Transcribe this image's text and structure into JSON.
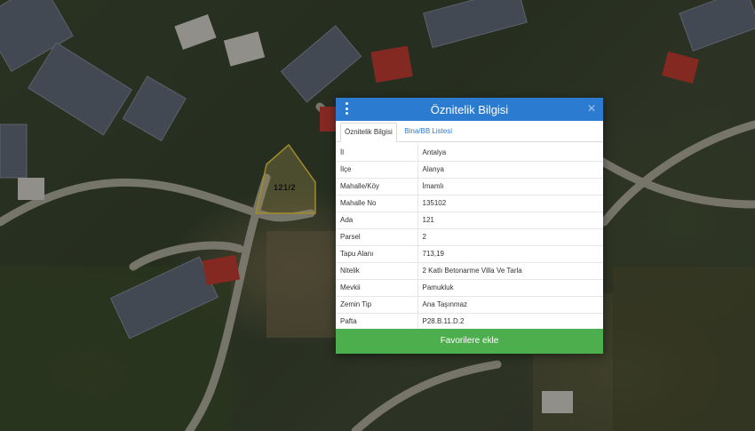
{
  "map": {
    "parcel_label": "121/2"
  },
  "dialog": {
    "title": "Öznitelik Bilgisi",
    "menu_icon": "vertical-dots-icon",
    "close_icon": "close-icon",
    "tabs": [
      {
        "label": "Öznitelik Bilgisi",
        "active": true
      },
      {
        "label": "Bina/BB Listesi",
        "active": false
      }
    ],
    "rows": [
      {
        "key": "İl",
        "value": "Antalya"
      },
      {
        "key": "İlçe",
        "value": "Alanya"
      },
      {
        "key": "Mahalle/Köy",
        "value": "İmamlı"
      },
      {
        "key": "Mahalle No",
        "value": "135102"
      },
      {
        "key": "Ada",
        "value": "121"
      },
      {
        "key": "Parsel",
        "value": "2"
      },
      {
        "key": "Tapu Alanı",
        "value": "713,19"
      },
      {
        "key": "Nitelik",
        "value": "2 Katlı Betonarme Villa Ve Tarla"
      },
      {
        "key": "Mevkii",
        "value": "Pamukluk"
      },
      {
        "key": "Zemin Tip",
        "value": "Ana Taşınmaz"
      },
      {
        "key": "Pafta",
        "value": "P28.B.11.D.2"
      }
    ],
    "favorite_button": "Favorilere ekle"
  },
  "colors": {
    "header": "#2b7bd0",
    "button": "#4cae4c",
    "parcel_outline": "#e0c23a"
  }
}
